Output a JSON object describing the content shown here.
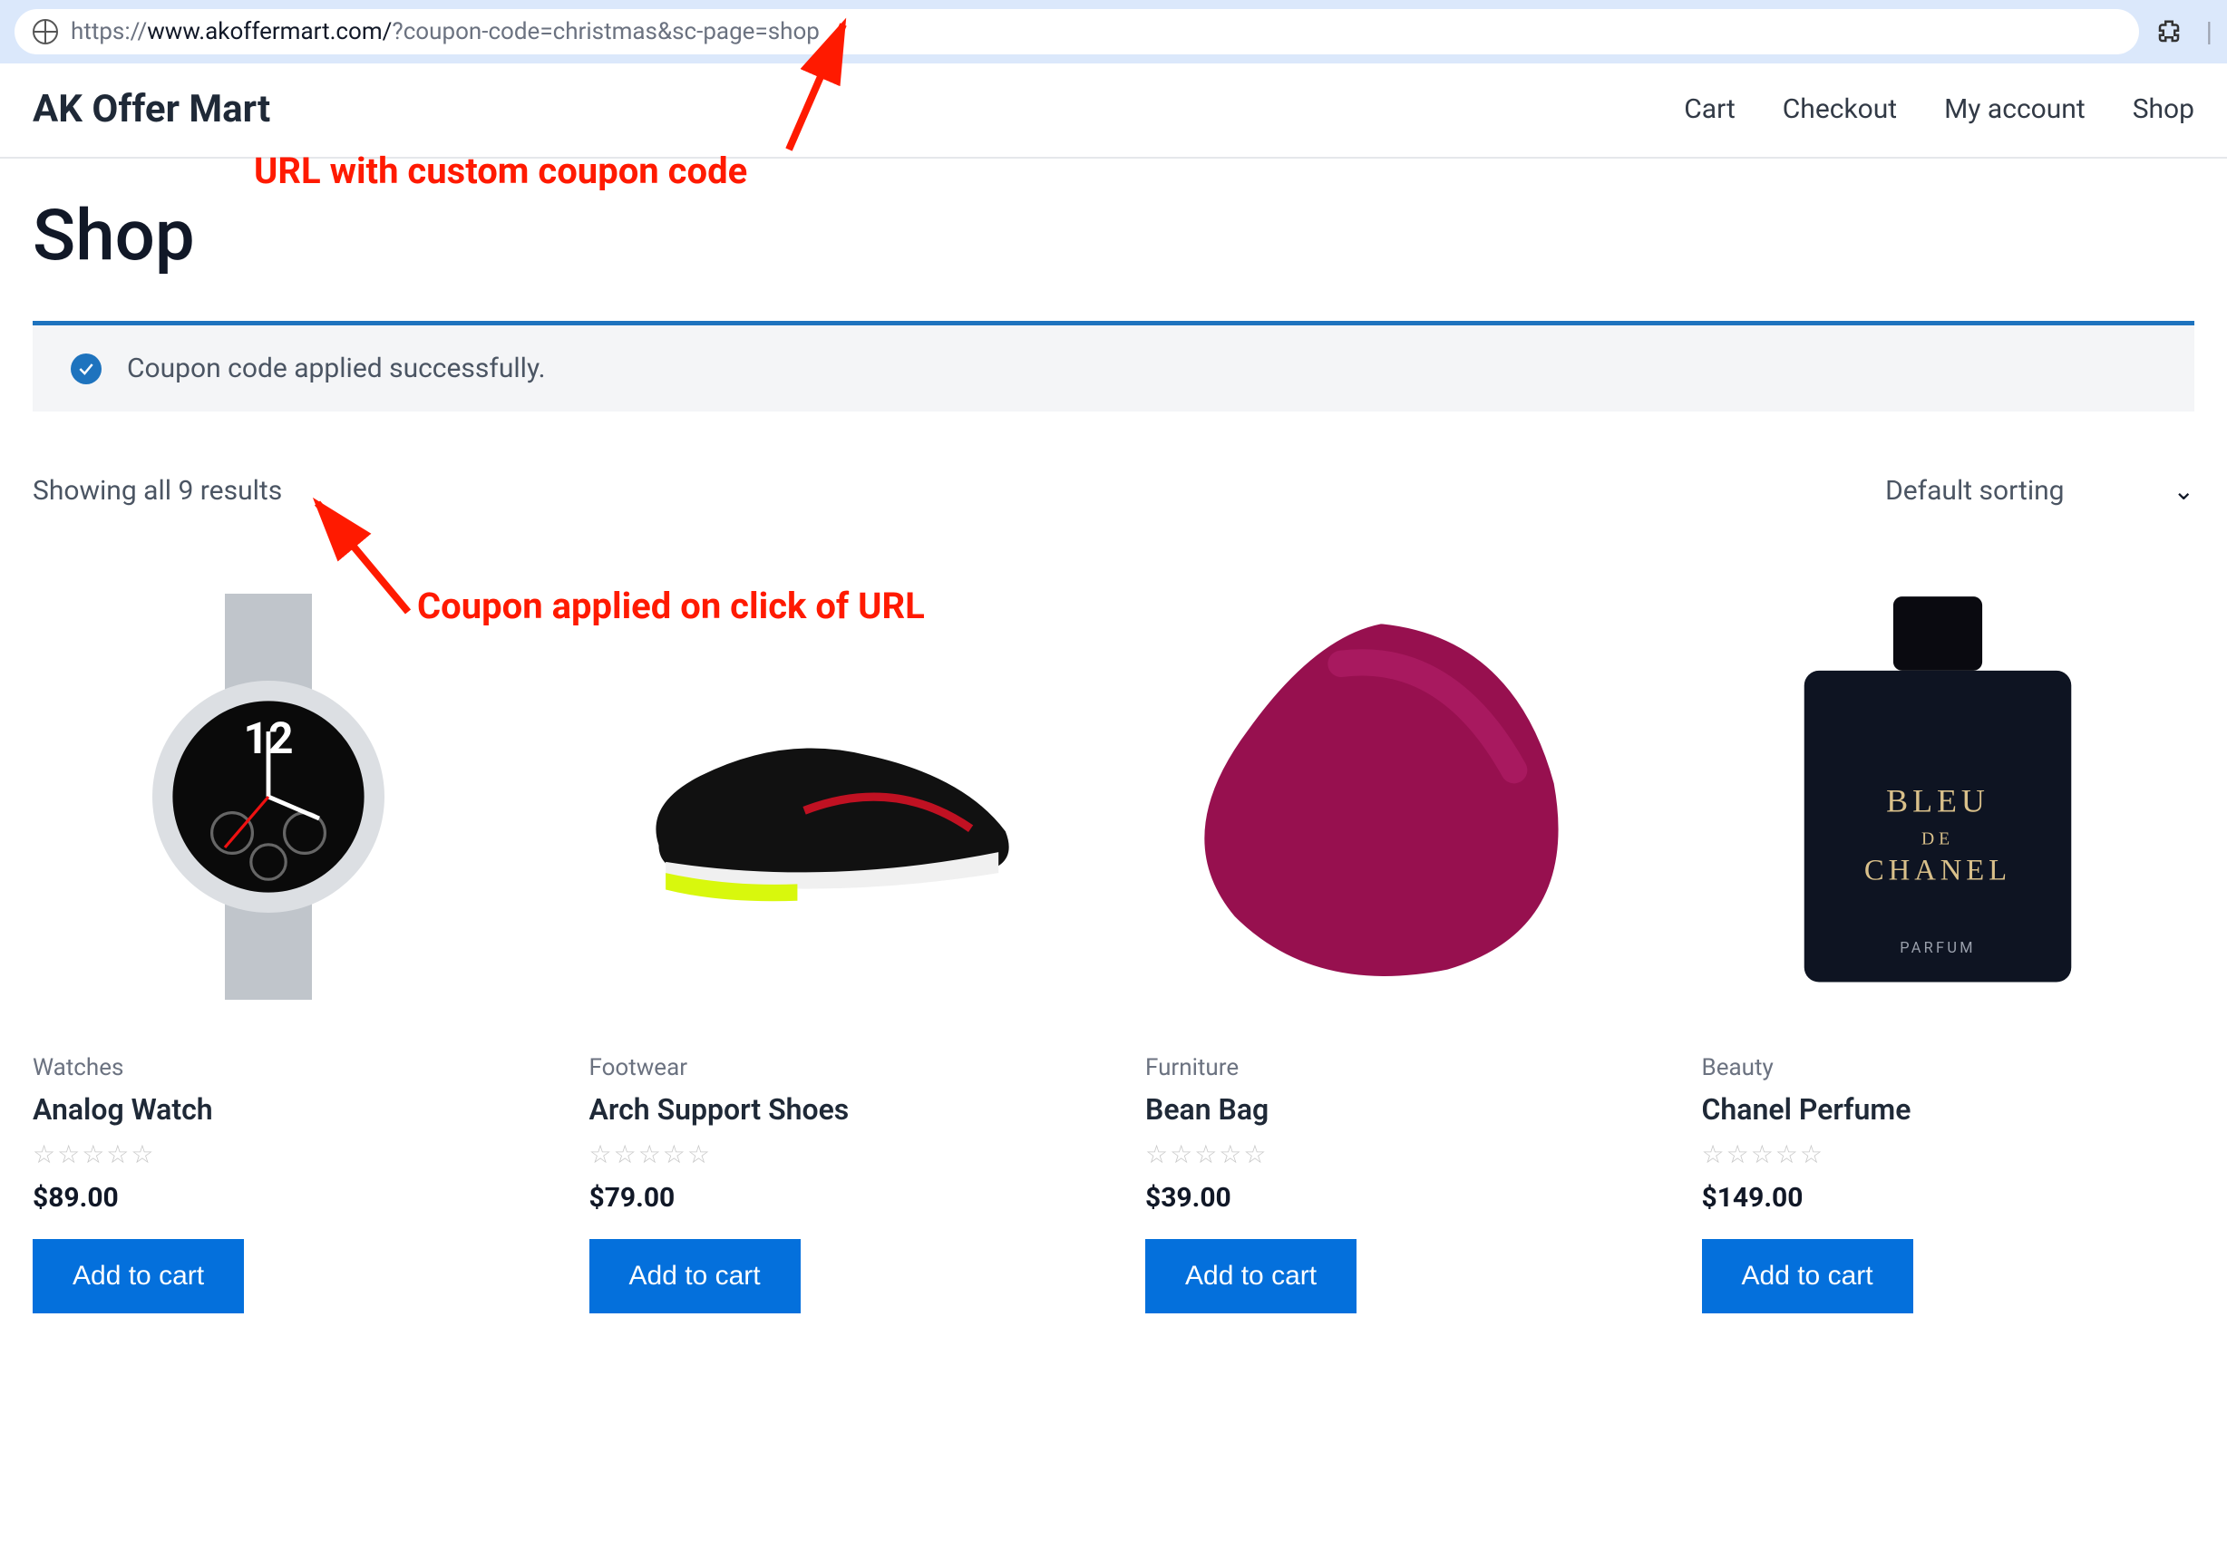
{
  "browser": {
    "url_prefix": "https://",
    "url_domain": "www.akoffermart.com/",
    "url_query": "?coupon-code=christmas&sc-page=shop"
  },
  "header": {
    "site_title": "AK Offer Mart",
    "nav": [
      "Cart",
      "Checkout",
      "My account",
      "Shop"
    ]
  },
  "page": {
    "title": "Shop",
    "alert": "Coupon code applied successfully.",
    "results_text": "Showing all 9 results",
    "sort_label": "Default sorting",
    "add_to_cart_label": "Add to cart"
  },
  "products": [
    {
      "category": "Watches",
      "name": "Analog Watch",
      "price": "$89.00"
    },
    {
      "category": "Footwear",
      "name": "Arch Support Shoes",
      "price": "$79.00"
    },
    {
      "category": "Furniture",
      "name": "Bean Bag",
      "price": "$39.00"
    },
    {
      "category": "Beauty",
      "name": "Chanel Perfume",
      "price": "$149.00"
    }
  ],
  "annotations": {
    "url_note": "URL with custom coupon code",
    "alert_note": "Coupon applied on click of URL"
  },
  "colors": {
    "accent": "#0470dc",
    "alert_border": "#1e73be",
    "annotation": "#ff1a00"
  }
}
